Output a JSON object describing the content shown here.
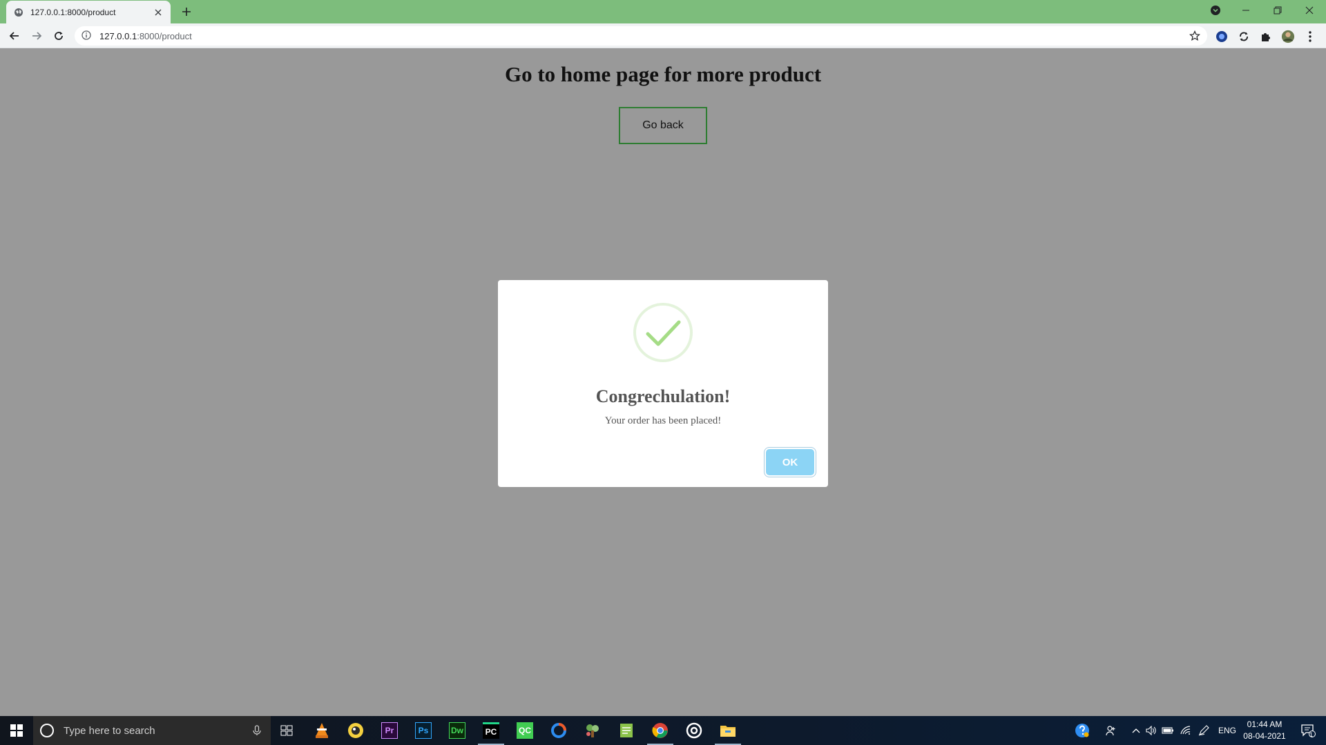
{
  "browser": {
    "tab_title": "127.0.0.1:8000/product",
    "url_host": "127.0.0.1",
    "url_rest": ":8000/product"
  },
  "page": {
    "heading": "Go to home page for more product",
    "go_back_label": "Go back"
  },
  "modal": {
    "title": "Congrechulation!",
    "message": "Your order has been placed!",
    "ok_label": "OK",
    "success_color": "#a5dc86",
    "ok_color": "#8cd4f5"
  },
  "taskbar": {
    "search_placeholder": "Type here to search",
    "apps": [
      "task-view",
      "vlc",
      "app-yellow",
      "premiere-pro",
      "photoshop",
      "dreamweaver",
      "pycharm",
      "qt-creator",
      "app-blue-ring",
      "app-tree",
      "app-notepad",
      "chrome",
      "app-target",
      "file-explorer"
    ],
    "app_labels": {
      "premiere": "Pr",
      "photoshop": "Ps",
      "dreamweaver": "Dw",
      "pycharm": "PC",
      "qt": "QC"
    },
    "language": "ENG",
    "time": "01:44 AM",
    "date": "08-04-2021",
    "notification_count": "1"
  }
}
